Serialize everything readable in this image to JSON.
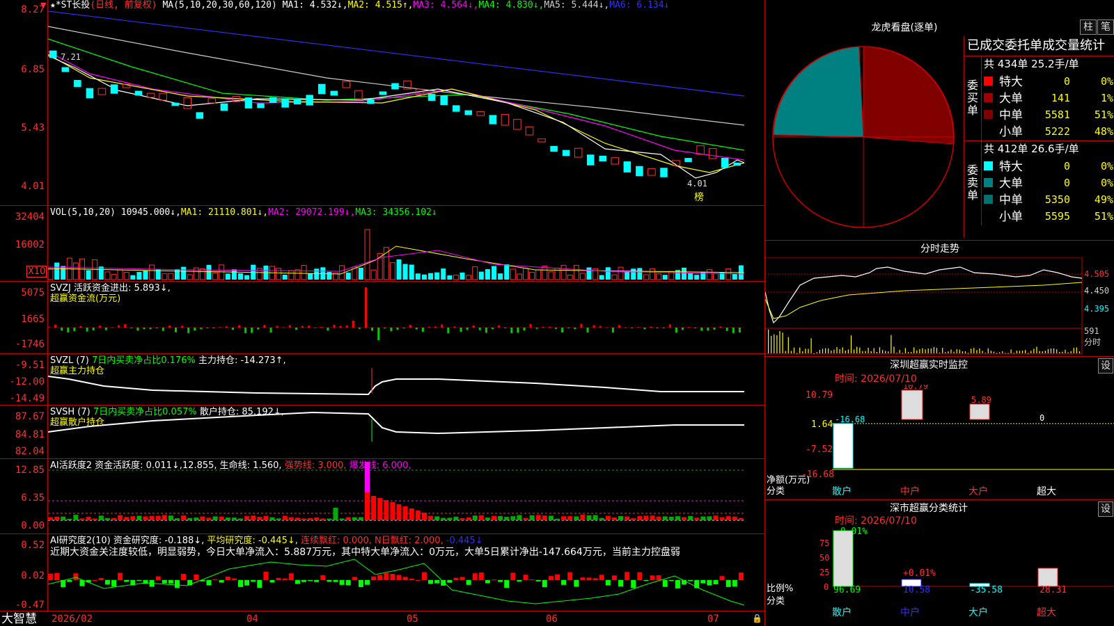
{
  "kline": {
    "stock_name": "★*ST长投",
    "mode": "(日线, 前复权)",
    "ma_label": "MA(5,10,20,30,60,120)",
    "ma_values": [
      {
        "label": "MA1: 4.532↓,",
        "color": "#ffffff"
      },
      {
        "label": "MA2: 4.515↑,",
        "color": "#ffff00"
      },
      {
        "label": "MA3: 4.564↓,",
        "color": "#ff00ff"
      },
      {
        "label": "MA4: 4.830↓,",
        "color": "#00ff00"
      },
      {
        "label": "MA5: 5.444↓,",
        "color": "#cccccc"
      },
      {
        "label": "MA6: 6.134↓",
        "color": "#3030ff"
      }
    ],
    "y_labels": [
      "8.27",
      "6.85",
      "5.43",
      "4.01"
    ],
    "high_mark": "7.21",
    "low_mark": "4.01",
    "bang_label": "榜"
  },
  "volume": {
    "title": "VOL(5,10,20)",
    "value": "10945.000↓,",
    "ma1": "MA1: 21110.801↓,",
    "ma2": "MA2: 29072.199↓,",
    "ma3": "MA3: 34356.102↓",
    "y_labels": [
      "32404",
      "16002"
    ],
    "unit": "X10"
  },
  "svzj": {
    "title": "SVZJ  活跃资金进出: 5.893↓,",
    "subtitle": "超赢资金流(万元)",
    "y_labels": [
      "5075",
      "1665",
      "-1746"
    ]
  },
  "svzl": {
    "title": "SVZL  (7)",
    "ratio": "7日内买卖净占比0.176%",
    "hold": "主力持仓: -14.273↑,",
    "subtitle": "超赢主力持仓",
    "y_labels": [
      "-9.51",
      "-12.00",
      "-14.49"
    ]
  },
  "svsh": {
    "title": "SVSH  (7)",
    "ratio": "7日内买卖净占比0.057%",
    "hold": "散户持仓: 85.192↓,",
    "subtitle": "超赢散户持仓",
    "y_labels": [
      "87.67",
      "84.81",
      "82.04"
    ]
  },
  "ai_active": {
    "title": "AI活跃度2",
    "fund": "资金活跃度: 0.011↓,",
    "v2": "12.855,",
    "life": "生命线: 1.560,",
    "strong": "强势线: 3.000,",
    "burst": "爆发线: 6.000,",
    "y_labels": [
      "12.85",
      "6.35",
      "0.00"
    ]
  },
  "ai_research": {
    "title": "AI研究度2(10)",
    "research": "资金研究度: -0.188↓,",
    "avg": "平均研究度: -0.445↓,",
    "red": "连续飘红: 0.000,",
    "nred": "N日飘红: 2.000,",
    "last": "-0.445↓",
    "comment": "近期大资金关注度较低，明显弱势，今日大单净流入：5.887万元，其中特大单净流入：0万元，大单5日累计净出-147.664万元，当前主力控盘弱",
    "y_labels": [
      "0.52",
      "0.02",
      "-0.47"
    ]
  },
  "x_axis": {
    "brand": "大智慧",
    "labels": [
      "2026/02",
      "04",
      "05",
      "06",
      "07"
    ]
  },
  "dragon": {
    "title": "龙虎看盘(逐单)",
    "btn_bar": "柱",
    "btn_pen": "笔",
    "stat_title": "已成交委托单成交量统计",
    "buy_summary": "共 434单 25.2手/单",
    "sell_summary": "共 412单 26.6手/单",
    "buy_label": "委买单",
    "sell_label": "委卖单",
    "buy_rows": [
      {
        "label": "特大",
        "count": "0",
        "pct": "0%",
        "color": "#ff0000"
      },
      {
        "label": "大单",
        "count": "141",
        "pct": "1%",
        "color": "#a00000"
      },
      {
        "label": "中单",
        "count": "5581",
        "pct": "51%",
        "color": "#800000"
      },
      {
        "label": "小单",
        "count": "5222",
        "pct": "48%",
        "color": "#000000"
      }
    ],
    "sell_rows": [
      {
        "label": "特大",
        "count": "0",
        "pct": "0%",
        "color": "#00ffff"
      },
      {
        "label": "大单",
        "count": "0",
        "pct": "0%",
        "color": "#008080"
      },
      {
        "label": "中单",
        "count": "5350",
        "pct": "49%",
        "color": "#007070"
      },
      {
        "label": "小单",
        "count": "5595",
        "pct": "51%",
        "color": "#000000"
      }
    ]
  },
  "intraday": {
    "title": "分时走势",
    "p1": "4.505",
    "p2": "4.450",
    "p3": "4.395",
    "vol": "591",
    "vol_unit": "分时"
  },
  "sz_monitor": {
    "title": "深圳超赢实时监控",
    "setting": "设",
    "time": "时间: 2026/07/10",
    "y_labels": [
      "10.79",
      "1.64",
      "-7.52",
      "-16.68"
    ],
    "bar_values": [
      "-16.68",
      "10.79",
      "5.89",
      "0"
    ],
    "ylabel": "净额(万元)",
    "xlabel": "分类",
    "categories": [
      "散户",
      "中户",
      "大户",
      "超大"
    ]
  },
  "sz_stat": {
    "title": "深市超赢分类统计",
    "setting": "设",
    "time": "时间: 2026/07/10",
    "top_value": "-0.01%",
    "mid_value": "+0.01%",
    "y_labels": [
      "75",
      "50",
      "25",
      "0"
    ],
    "bottom_values": [
      "96.69",
      "10.58",
      "-35.58",
      "28.31"
    ],
    "ylabel": "比例%",
    "xlabel": "分类",
    "categories": [
      "散户",
      "中户",
      "大户",
      "超大"
    ]
  }
}
